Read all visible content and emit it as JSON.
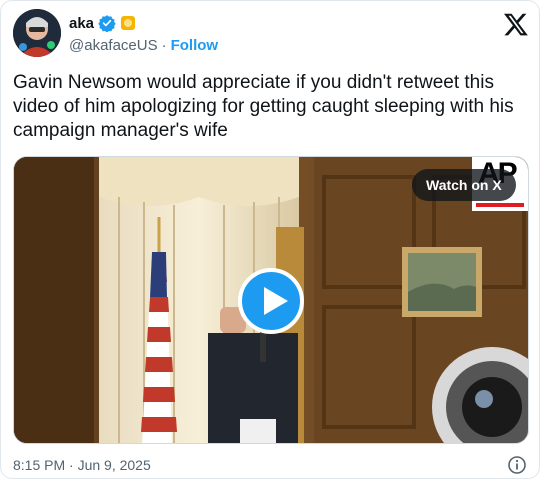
{
  "author": {
    "display_name": "aka",
    "handle": "@akafaceUS",
    "follow_label": "Follow",
    "separator": "·"
  },
  "tweet": {
    "text": "Gavin Newsom would appreciate if you didn't retweet this video of him apologizing for getting caught sleeping with his campaign manager's wife"
  },
  "media": {
    "watch_label": "Watch on X",
    "source_logo": "AP"
  },
  "footer": {
    "timestamp": "8:15 PM · Jun 9, 2025"
  },
  "icons": {
    "verified": "verified-badge-icon",
    "emoji": "emoji-badge-icon",
    "brand": "x-logo-icon",
    "play": "play-icon",
    "info": "info-icon"
  },
  "colors": {
    "accent": "#1d9bf0",
    "text": "#0f1419",
    "muted": "#536471",
    "border": "#cfd9de"
  }
}
